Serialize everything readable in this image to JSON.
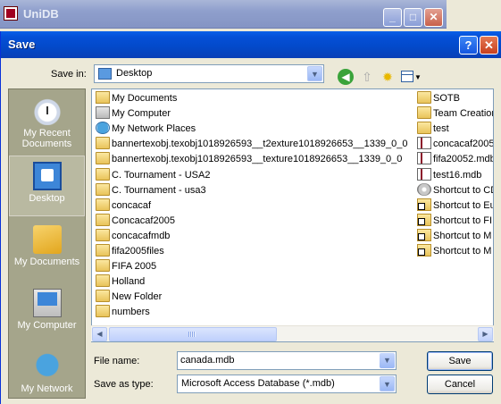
{
  "background_window": {
    "title": "UniDB"
  },
  "dialog": {
    "title": "Save",
    "help_glyph": "?",
    "close_glyph": "✕"
  },
  "save_in": {
    "label": "Save in:",
    "value": "Desktop",
    "icon": "desktop-icon"
  },
  "toolbar": {
    "icons": [
      "back-icon",
      "up-folder-icon",
      "new-folder-icon",
      "views-menu-icon"
    ]
  },
  "places": [
    {
      "label": "My Recent Documents",
      "icon": "recent-documents-icon",
      "active": false
    },
    {
      "label": "Desktop",
      "icon": "desktop-icon",
      "active": true
    },
    {
      "label": "My Documents",
      "icon": "my-documents-icon",
      "active": false
    },
    {
      "label": "My Computer",
      "icon": "my-computer-icon",
      "active": false
    },
    {
      "label": "My Network",
      "icon": "my-network-icon",
      "active": false
    }
  ],
  "files": {
    "column1": [
      {
        "name": "My Documents",
        "type": "mydocs"
      },
      {
        "name": "My Computer",
        "type": "mycomp"
      },
      {
        "name": "My Network Places",
        "type": "netplaces"
      },
      {
        "name": "bannertexobj.texobj1018926593__t2exture1018926653__1339_0_0",
        "type": "folder"
      },
      {
        "name": "bannertexobj.texobj1018926593__texture1018926653__1339_0_0",
        "type": "folder"
      },
      {
        "name": "C. Tournament - USA2",
        "type": "folder"
      },
      {
        "name": "C. Tournament - usa3",
        "type": "folder"
      },
      {
        "name": "concacaf",
        "type": "folder"
      },
      {
        "name": "Concacaf2005",
        "type": "folder"
      },
      {
        "name": "concacafmdb",
        "type": "folder"
      },
      {
        "name": "fifa2005files",
        "type": "folder"
      },
      {
        "name": "FIFA 2005",
        "type": "folder"
      },
      {
        "name": "Holland",
        "type": "folder"
      },
      {
        "name": "New Folder",
        "type": "folder"
      },
      {
        "name": "numbers",
        "type": "folder"
      }
    ],
    "column2": [
      {
        "name": "SOTB",
        "type": "folder"
      },
      {
        "name": "Team Creation",
        "type": "folder"
      },
      {
        "name": "test",
        "type": "folder"
      },
      {
        "name": "concacaf2005",
        "type": "mdb"
      },
      {
        "name": "fifa20052.mdb",
        "type": "mdb"
      },
      {
        "name": "test16.mdb",
        "type": "mdb"
      },
      {
        "name": "Shortcut to CD",
        "type": "cdrom"
      },
      {
        "name": "Shortcut to Eu",
        "type": "shortcut"
      },
      {
        "name": "Shortcut to FI",
        "type": "shortcut"
      },
      {
        "name": "Shortcut to M",
        "type": "shortcut"
      },
      {
        "name": "Shortcut to M",
        "type": "shortcut"
      }
    ]
  },
  "file_name": {
    "label": "File name:",
    "value": "canada.mdb"
  },
  "save_as_type": {
    "label": "Save as type:",
    "value": "Microsoft Access Database (*.mdb)"
  },
  "buttons": {
    "save": "Save",
    "cancel": "Cancel"
  },
  "colors": {
    "titlebar": "#0450d8",
    "places_bg": "#a5a58b",
    "dialog_bg": "#ece9d8"
  }
}
